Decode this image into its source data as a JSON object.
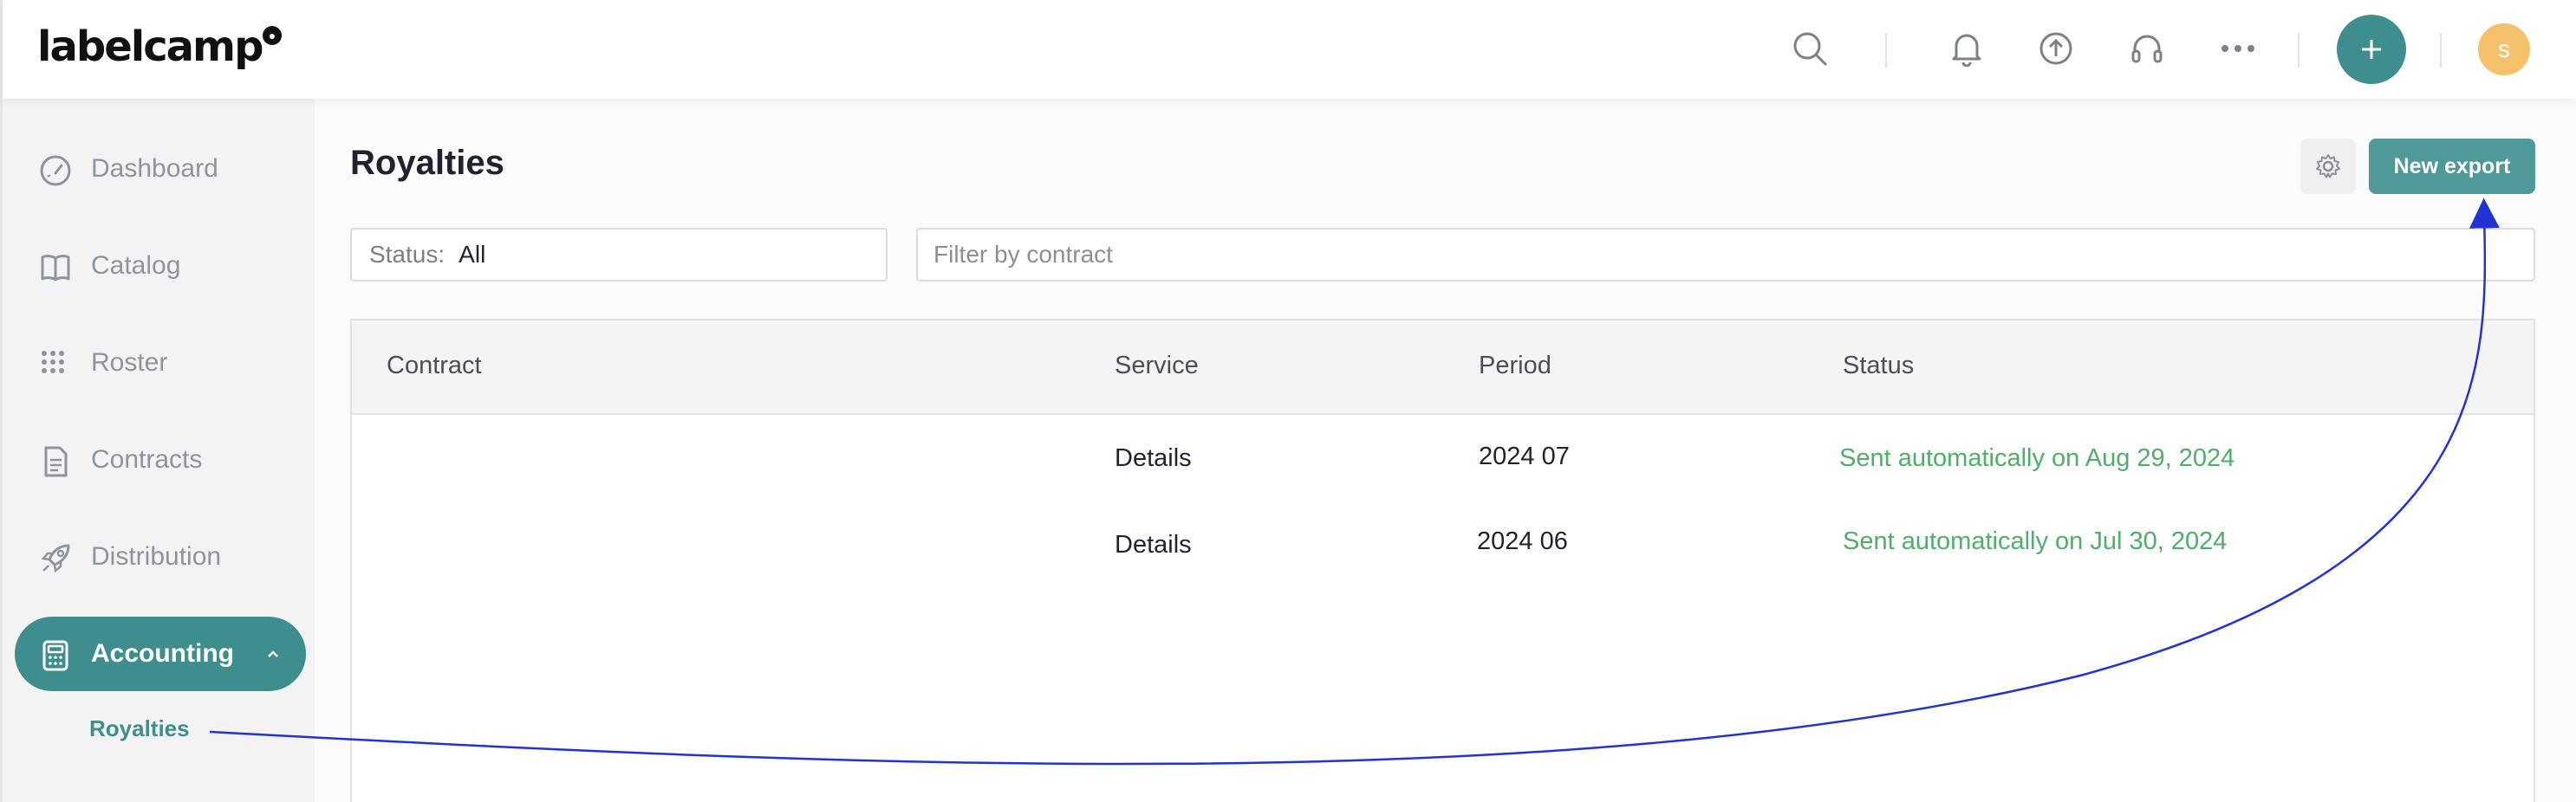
{
  "app": {
    "logo_text": "labelcamp",
    "logo_badge": "●"
  },
  "topbar": {
    "icons": [
      "search-icon",
      "bell-icon",
      "upload-icon",
      "headset-icon",
      "more-icon",
      "plus-icon"
    ],
    "avatar_initial": "s",
    "accent_color": "#3d8e8c",
    "avatar_color": "#f5c26b"
  },
  "sidebar": {
    "items": [
      {
        "label": "Dashboard",
        "icon": "gauge-icon"
      },
      {
        "label": "Catalog",
        "icon": "book-icon"
      },
      {
        "label": "Roster",
        "icon": "grid-icon"
      },
      {
        "label": "Contracts",
        "icon": "document-icon"
      },
      {
        "label": "Distribution",
        "icon": "rocket-icon"
      },
      {
        "label": "Accounting",
        "icon": "calculator-icon",
        "active": true
      }
    ],
    "subitems": [
      {
        "label": "Royalties",
        "active": true
      }
    ]
  },
  "page": {
    "title": "Royalties",
    "new_export_label": "New export",
    "filters": {
      "status_label": "Status:",
      "status_value": "All",
      "contract_placeholder": "Filter by contract"
    }
  },
  "table": {
    "columns": [
      "Contract",
      "Service",
      "Period",
      "Status"
    ],
    "rows": [
      {
        "contract": "",
        "service": "Details",
        "period": "2024 07",
        "status": "Sent automatically on Aug 29, 2024"
      },
      {
        "contract": "",
        "service": "Details",
        "period": "2024 06",
        "status": "Sent automatically on Jul 30, 2024"
      }
    ],
    "status_color": "#4fae69"
  },
  "annotation": {
    "arrow_color": "#2233d6"
  }
}
